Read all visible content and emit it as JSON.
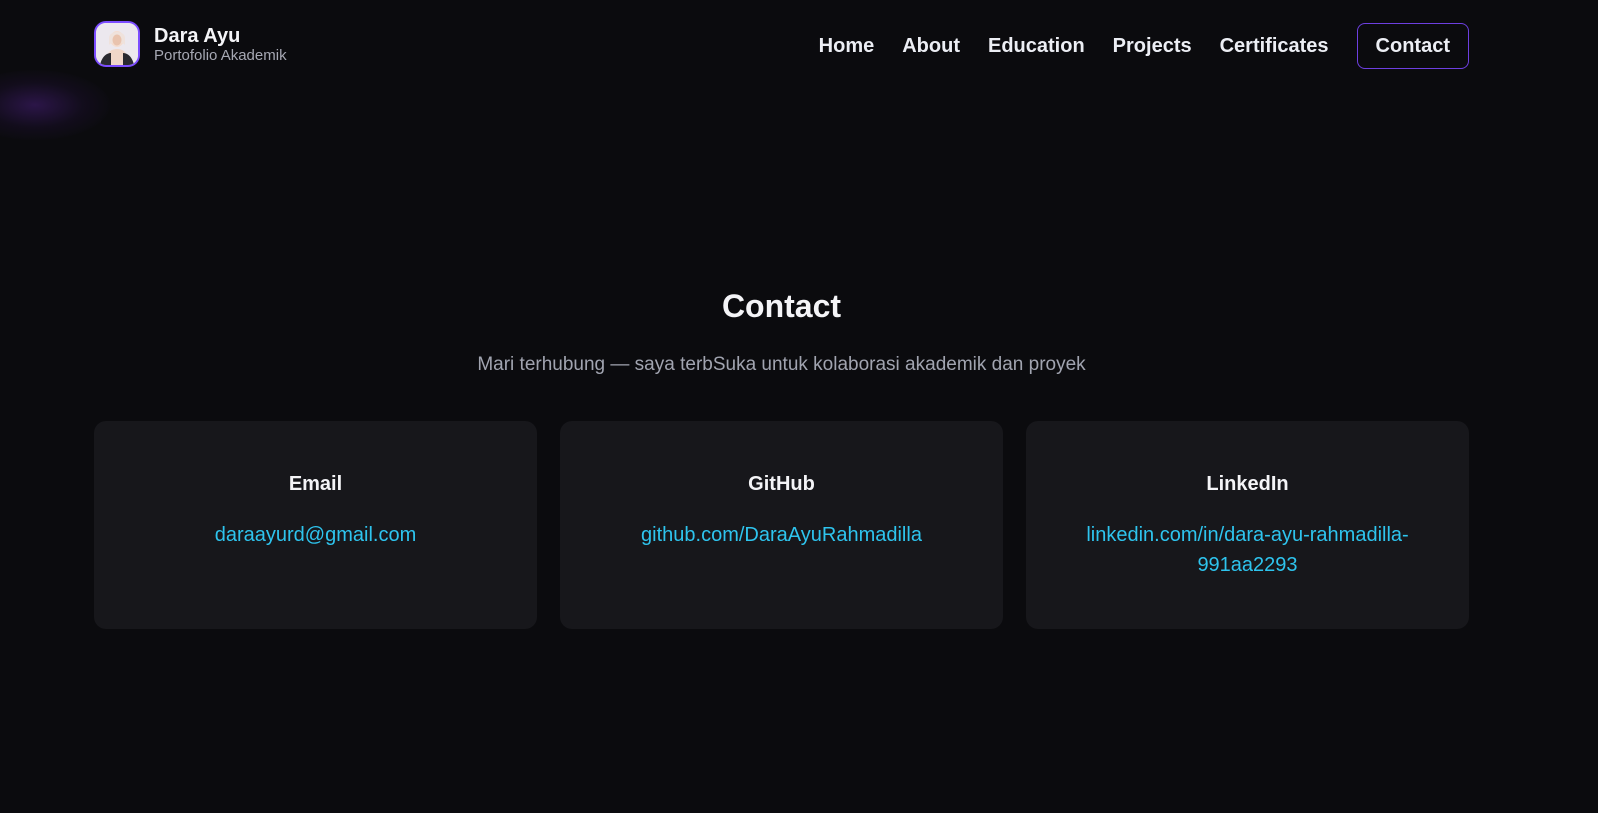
{
  "brand": {
    "name": "Dara Ayu",
    "subtitle": "Portofolio Akademik",
    "avatar": "avatar-photo"
  },
  "nav": {
    "items": [
      {
        "label": "Home"
      },
      {
        "label": "About"
      },
      {
        "label": "Education"
      },
      {
        "label": "Projects"
      },
      {
        "label": "Certificates"
      }
    ],
    "cta": "Contact"
  },
  "contact": {
    "title": "Contact",
    "subtitle": "Mari terhubung — saya terbSuka untuk kolaborasi akademik dan proyek",
    "cards": [
      {
        "title": "Email",
        "value": "daraayurd@gmail.com"
      },
      {
        "title": "GitHub",
        "value": "github.com/DaraAyuRahmadilla"
      },
      {
        "title": "LinkedIn",
        "value": "linkedin.com/in/dara-ayu-rahmadilla-991aa2293"
      }
    ]
  },
  "colors": {
    "background": "#0b0b0e",
    "card": "#17171b",
    "accent": "#6d3fe0",
    "link": "#2ec4ee",
    "muted": "#a1a4b0"
  }
}
